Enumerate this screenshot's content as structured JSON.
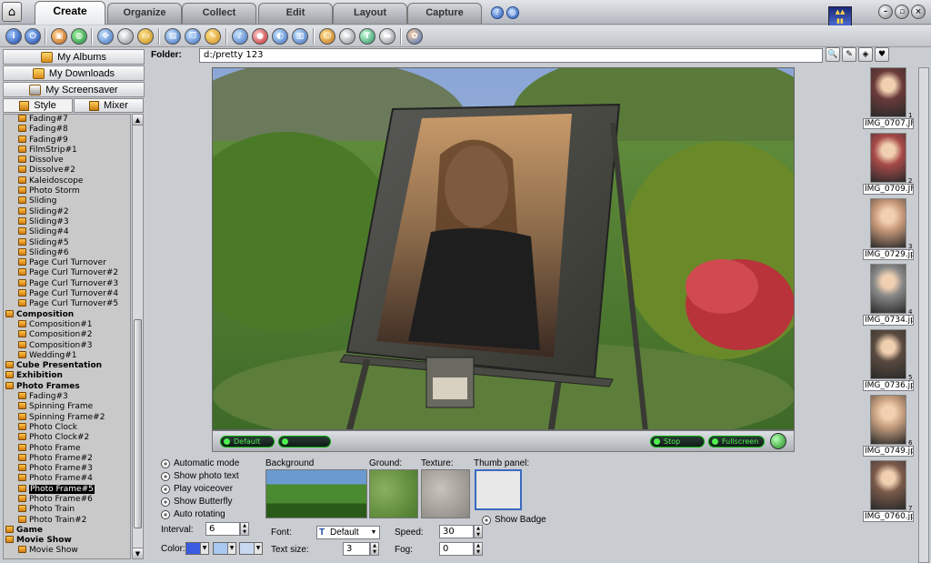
{
  "tabs": [
    "Create",
    "Organize",
    "Collect",
    "Edit",
    "Layout",
    "Capture"
  ],
  "active_tab": "Create",
  "nav": {
    "albums": "My Albums",
    "downloads": "My Downloads",
    "screensaver": "My Screensaver"
  },
  "subtabs": {
    "style": "Style",
    "mixer": "Mixer"
  },
  "tree": [
    {
      "t": "Fading#7",
      "k": "item"
    },
    {
      "t": "Fading#8",
      "k": "item"
    },
    {
      "t": "Fading#9",
      "k": "item"
    },
    {
      "t": "FilmStrip#1",
      "k": "item"
    },
    {
      "t": "Dissolve",
      "k": "item"
    },
    {
      "t": "Dissolve#2",
      "k": "item"
    },
    {
      "t": "Kaleidoscope",
      "k": "item"
    },
    {
      "t": "Photo Storm",
      "k": "item"
    },
    {
      "t": "Sliding",
      "k": "item"
    },
    {
      "t": "Sliding#2",
      "k": "item"
    },
    {
      "t": "Sliding#3",
      "k": "item"
    },
    {
      "t": "Sliding#4",
      "k": "item"
    },
    {
      "t": "Sliding#5",
      "k": "item"
    },
    {
      "t": "Sliding#6",
      "k": "item"
    },
    {
      "t": "Page Curl Turnover",
      "k": "item"
    },
    {
      "t": "Page Curl Turnover#2",
      "k": "item"
    },
    {
      "t": "Page Curl Turnover#3",
      "k": "item"
    },
    {
      "t": "Page Curl Turnover#4",
      "k": "item"
    },
    {
      "t": "Page Curl Turnover#5",
      "k": "item"
    },
    {
      "t": "Composition",
      "k": "cat"
    },
    {
      "t": "Composition#1",
      "k": "item"
    },
    {
      "t": "Composition#2",
      "k": "item"
    },
    {
      "t": "Composition#3",
      "k": "item"
    },
    {
      "t": "Wedding#1",
      "k": "item"
    },
    {
      "t": "Cube Presentation",
      "k": "cat"
    },
    {
      "t": "Exhibition",
      "k": "cat"
    },
    {
      "t": "Photo Frames",
      "k": "cat"
    },
    {
      "t": "Fading#3",
      "k": "item"
    },
    {
      "t": "Spinning Frame",
      "k": "item"
    },
    {
      "t": "Spinning Frame#2",
      "k": "item"
    },
    {
      "t": "Photo Clock",
      "k": "item"
    },
    {
      "t": "Photo Clock#2",
      "k": "item"
    },
    {
      "t": "Photo Frame",
      "k": "item"
    },
    {
      "t": "Photo Frame#2",
      "k": "item"
    },
    {
      "t": "Photo Frame#3",
      "k": "item"
    },
    {
      "t": "Photo Frame#4",
      "k": "item"
    },
    {
      "t": "Photo Frame#5",
      "k": "item",
      "sel": true
    },
    {
      "t": "Photo Frame#6",
      "k": "item"
    },
    {
      "t": "Photo Train",
      "k": "item"
    },
    {
      "t": "Photo Train#2",
      "k": "item"
    },
    {
      "t": "Game",
      "k": "cat"
    },
    {
      "t": "Movie Show",
      "k": "cat"
    },
    {
      "t": "Movie Show",
      "k": "item"
    }
  ],
  "folder": {
    "label": "Folder:",
    "value": "d:/pretty  123"
  },
  "controls": {
    "default": "Default",
    "stop": "Stop",
    "fullscreen": "Fullscreen"
  },
  "options": {
    "checks": [
      "Automatic mode",
      "Show photo text",
      "Play voiceover",
      "Show Butterfly",
      "Auto rotating"
    ],
    "interval_label": "Interval:",
    "interval": "6",
    "color_label": "Color:",
    "background": "Background",
    "ground": "Ground:",
    "texture": "Texture:",
    "thumb_panel": "Thumb panel:",
    "show_badge": "Show Badge",
    "font_label": "Font:",
    "font": "Default",
    "textsize_label": "Text size:",
    "textsize": "3",
    "speed_label": "Speed:",
    "speed": "30",
    "fog_label": "Fog:",
    "fog": "0"
  },
  "strip": [
    {
      "name": "IMG_0707.JF",
      "n": "1"
    },
    {
      "name": "IMG_0709.JF",
      "n": "2"
    },
    {
      "name": "IMG_0729.jp",
      "n": "3"
    },
    {
      "name": "IMG_0734.jp",
      "n": "4"
    },
    {
      "name": "IMG_0736.jp",
      "n": "5"
    },
    {
      "name": "IMG_0749.jp",
      "n": "6"
    },
    {
      "name": "IMG_0760.jp",
      "n": "7"
    }
  ],
  "colors": {
    "selection": "#000000",
    "accent_green": "#4ef04e",
    "toolbar_blue": "#2457b4"
  }
}
